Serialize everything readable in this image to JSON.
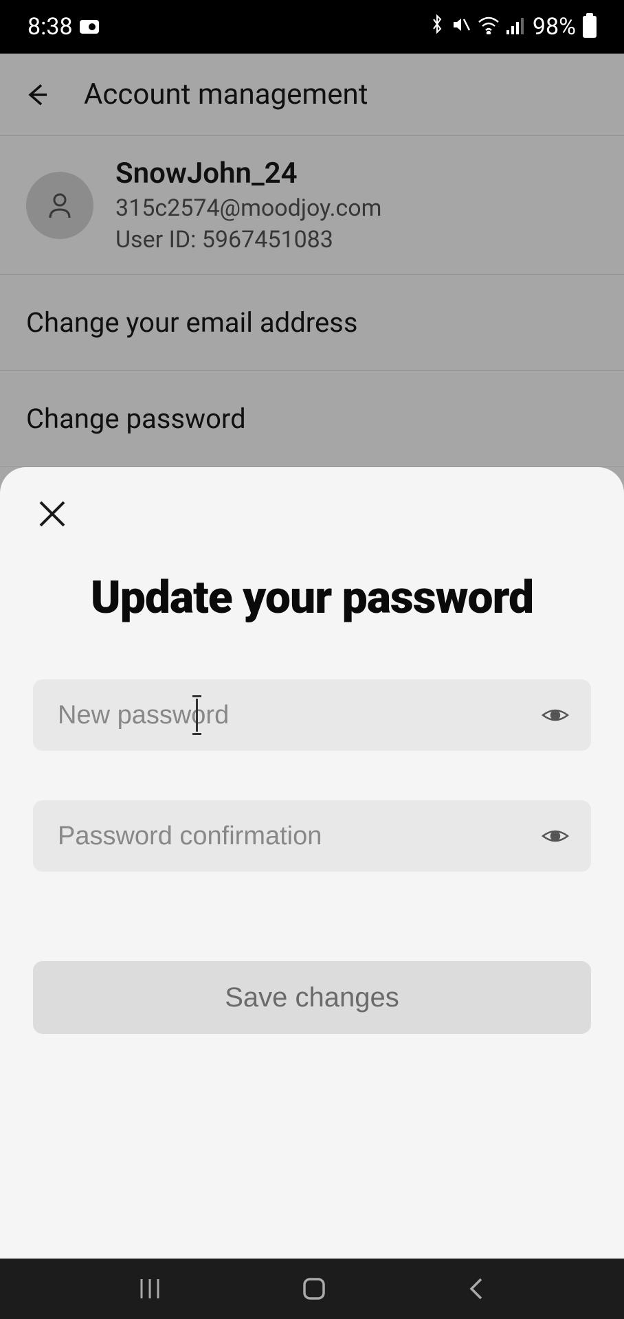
{
  "statusBar": {
    "time": "8:38",
    "batteryPercent": "98%"
  },
  "header": {
    "title": "Account management"
  },
  "user": {
    "username": "SnowJohn_24",
    "email": "315c2574@moodjoy.com",
    "idLabel": "User ID: 5967451083"
  },
  "menu": {
    "changeEmail": "Change your email address",
    "changePassword": "Change password"
  },
  "sheet": {
    "title": "Update your password",
    "newPasswordPlaceholder": "New password",
    "confirmPasswordPlaceholder": "Password confirmation",
    "saveButton": "Save changes"
  }
}
